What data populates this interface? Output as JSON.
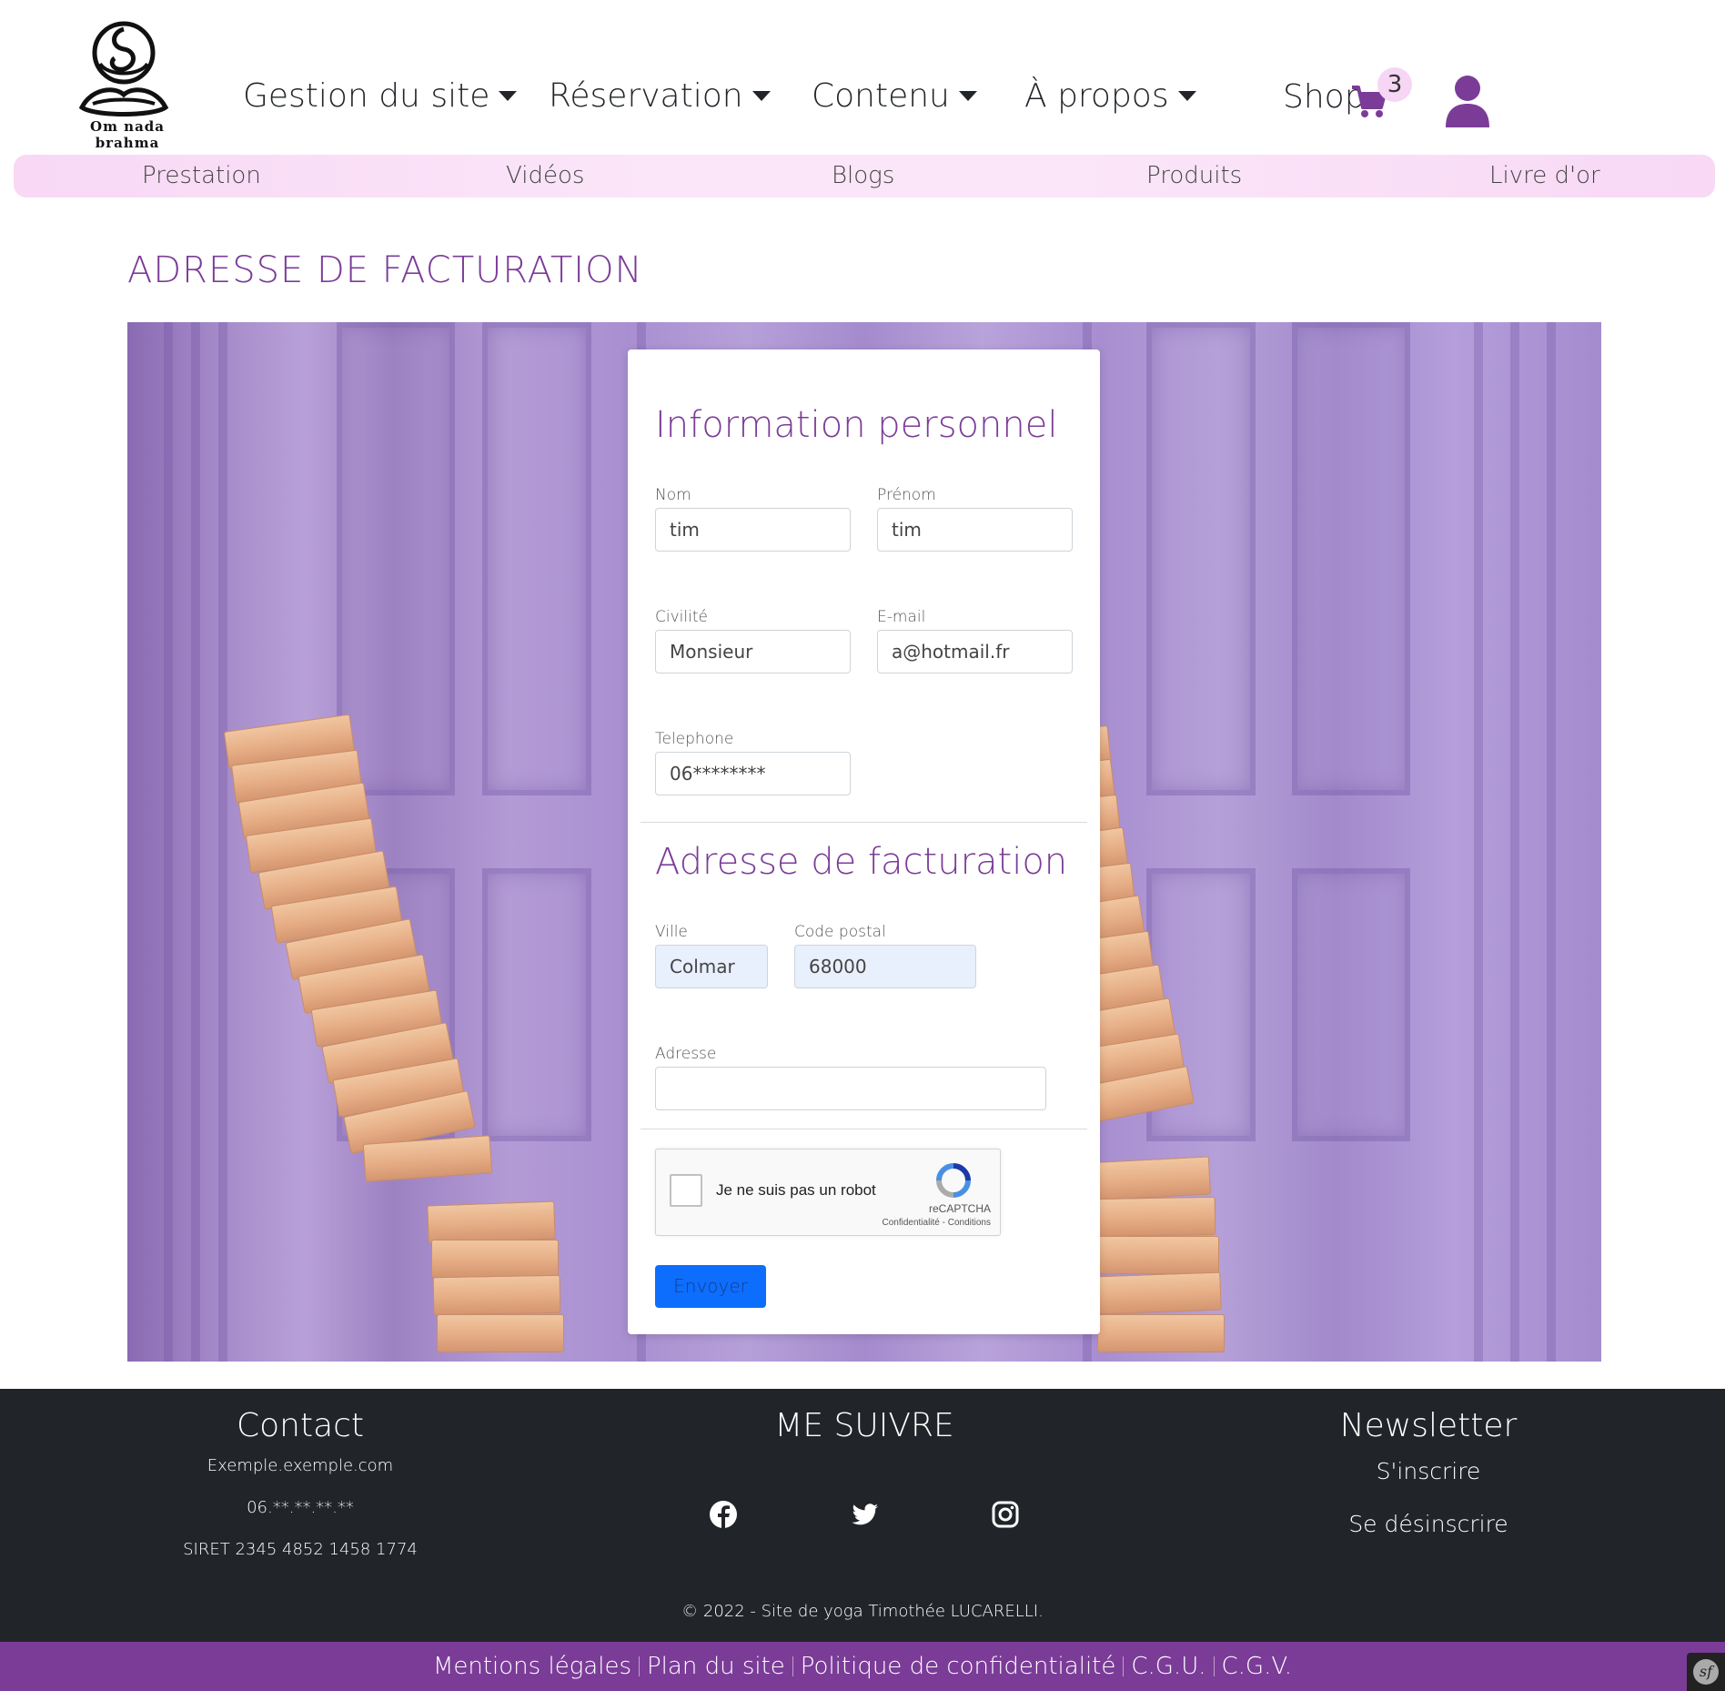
{
  "brand": {
    "logo_text": "Om nada brahma",
    "logo_icon": "meditation-figure-icon"
  },
  "header": {
    "nav": [
      {
        "label": "Gestion du site"
      },
      {
        "label": "Réservation"
      },
      {
        "label": "Contenu"
      },
      {
        "label": "À propos"
      }
    ],
    "shop_label": "Shop",
    "cart_count": "3",
    "cart_icon": "cart-icon",
    "user_icon": "user-icon"
  },
  "subnav": {
    "items": [
      {
        "label": "Prestation"
      },
      {
        "label": "Vidéos"
      },
      {
        "label": "Blogs"
      },
      {
        "label": "Produits"
      },
      {
        "label": "Livre d'or"
      }
    ]
  },
  "page": {
    "title": "ADRESSE DE FACTURATION"
  },
  "form": {
    "personal_title": "Information personnel",
    "billing_title": "Adresse de facturation",
    "nom": {
      "label": "Nom",
      "value": "tim"
    },
    "prenom": {
      "label": "Prénom",
      "value": "tim"
    },
    "civilite": {
      "label": "Civilité",
      "value": "Monsieur"
    },
    "email": {
      "label": "E-mail",
      "value": "a@hotmail.fr"
    },
    "telephone": {
      "label": "Telephone",
      "value": "06********"
    },
    "ville": {
      "label": "Ville",
      "value": "Colmar"
    },
    "code_postal": {
      "label": "Code postal",
      "value": "68000"
    },
    "adresse": {
      "label": "Adresse",
      "value": ""
    },
    "captcha": {
      "label": "Je ne suis pas un robot",
      "brand": "reCAPTCHA",
      "links": "Confidentialité - Conditions"
    },
    "submit_label": "Envoyer"
  },
  "footer": {
    "contact": {
      "heading": "Contact",
      "email": "Exemple.exemple.com",
      "phone": "06.**.**.**.**",
      "siret": "SIRET 2345 4852 1458 1774"
    },
    "social": {
      "heading": "ME SUIVRE",
      "icons": [
        "facebook-icon",
        "twitter-icon",
        "instagram-icon"
      ]
    },
    "newsletter": {
      "heading": "Newsletter",
      "subscribe": "S'inscrire",
      "unsubscribe": "Se désinscrire"
    },
    "copyright": "© 2022 - Site de yoga Timothée LUCARELLI."
  },
  "legal": {
    "links": [
      {
        "label": "Mentions légales"
      },
      {
        "label": "Plan du site"
      },
      {
        "label": "Politique de confidentialité"
      },
      {
        "label": "C.G.U."
      },
      {
        "label": "C.G.V."
      }
    ]
  },
  "colors": {
    "accent": "#7b3c98",
    "subnav_bg": "#f8d8f5",
    "footer_bg": "#212529",
    "button": "#0d6efd"
  }
}
